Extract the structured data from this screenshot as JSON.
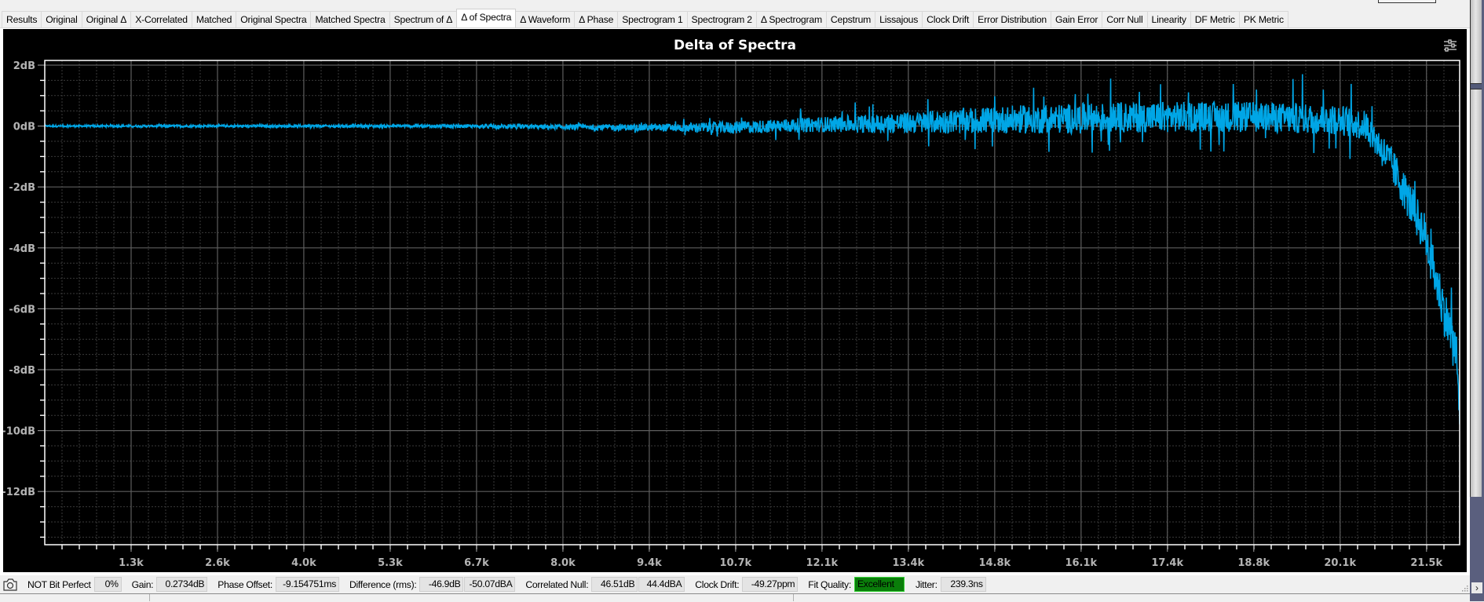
{
  "tabs": [
    {
      "label": "Results"
    },
    {
      "label": "Original"
    },
    {
      "label": "Original Δ"
    },
    {
      "label": "X-Correlated"
    },
    {
      "label": "Matched"
    },
    {
      "label": "Original Spectra"
    },
    {
      "label": "Matched Spectra"
    },
    {
      "label": "Spectrum of Δ"
    },
    {
      "label": "Δ of Spectra",
      "active": true
    },
    {
      "label": "Δ Waveform"
    },
    {
      "label": "Δ Phase"
    },
    {
      "label": "Spectrogram 1"
    },
    {
      "label": "Spectrogram 2"
    },
    {
      "label": "Δ Spectrogram"
    },
    {
      "label": "Cepstrum"
    },
    {
      "label": "Lissajous"
    },
    {
      "label": "Clock Drift"
    },
    {
      "label": "Error Distribution"
    },
    {
      "label": "Gain Error"
    },
    {
      "label": "Corr Null"
    },
    {
      "label": "Linearity"
    },
    {
      "label": "DF Metric"
    },
    {
      "label": "PK Metric"
    }
  ],
  "chart": {
    "settings_icon": "sliders-icon",
    "trace_color": "#00a6e6"
  },
  "chart_data": {
    "type": "line",
    "title": "Delta of Spectra",
    "xlabel": "",
    "ylabel": "",
    "xlim": [
      0,
      22050
    ],
    "ylim": [
      -13.7,
      2.2
    ],
    "grid": true,
    "legend": "none",
    "x_ticks": [
      {
        "value": 1346,
        "label": "1.3k"
      },
      {
        "value": 2692,
        "label": "2.6k"
      },
      {
        "value": 4037,
        "label": "4.0k"
      },
      {
        "value": 5383,
        "label": "5.3k"
      },
      {
        "value": 6729,
        "label": "6.7k"
      },
      {
        "value": 8075,
        "label": "8.0k"
      },
      {
        "value": 9421,
        "label": "9.4k"
      },
      {
        "value": 10766,
        "label": "10.7k"
      },
      {
        "value": 12112,
        "label": "12.1k"
      },
      {
        "value": 13458,
        "label": "13.4k"
      },
      {
        "value": 14804,
        "label": "14.8k"
      },
      {
        "value": 16150,
        "label": "16.1k"
      },
      {
        "value": 17495,
        "label": "17.4k"
      },
      {
        "value": 18841,
        "label": "18.8k"
      },
      {
        "value": 20187,
        "label": "20.1k"
      },
      {
        "value": 21533,
        "label": "21.5k"
      }
    ],
    "y_ticks": [
      {
        "value": 2,
        "label": "2dB"
      },
      {
        "value": 0,
        "label": "0dB"
      },
      {
        "value": -2,
        "label": "-2dB"
      },
      {
        "value": -4,
        "label": "-4dB"
      },
      {
        "value": -6,
        "label": "-6dB"
      },
      {
        "value": -8,
        "label": "-8dB"
      },
      {
        "value": -10,
        "label": "-10dB"
      },
      {
        "value": -12,
        "label": "-12dB"
      }
    ],
    "series": [
      {
        "name": "Delta of Spectra",
        "description": "Noisy delta trace: envelope given as frequency (Hz), mean (dB), spread (dB, +/- noise), max spike (dB)",
        "envelope": [
          {
            "f": 0,
            "mean": 0.0,
            "spread": 0.03,
            "spike": 0.05
          },
          {
            "f": 6000,
            "mean": 0.0,
            "spread": 0.05,
            "spike": 0.08
          },
          {
            "f": 8000,
            "mean": -0.03,
            "spread": 0.08,
            "spike": 0.15
          },
          {
            "f": 9500,
            "mean": -0.05,
            "spread": 0.12,
            "spike": 0.25
          },
          {
            "f": 10700,
            "mean": -0.05,
            "spread": 0.2,
            "spike": 0.45
          },
          {
            "f": 12100,
            "mean": 0.05,
            "spread": 0.25,
            "spike": 0.6
          },
          {
            "f": 13400,
            "mean": 0.1,
            "spread": 0.35,
            "spike": 0.9
          },
          {
            "f": 14800,
            "mean": 0.2,
            "spread": 0.45,
            "spike": 1.1
          },
          {
            "f": 16100,
            "mean": 0.25,
            "spread": 0.5,
            "spike": 1.3
          },
          {
            "f": 17400,
            "mean": 0.3,
            "spread": 0.5,
            "spike": 1.3
          },
          {
            "f": 18800,
            "mean": 0.3,
            "spread": 0.5,
            "spike": 1.3
          },
          {
            "f": 20200,
            "mean": 0.2,
            "spread": 0.5,
            "spike": 1.6
          },
          {
            "f": 20600,
            "mean": 0.0,
            "spread": 0.5,
            "spike": 1.2
          },
          {
            "f": 21000,
            "mean": -1.3,
            "spread": 0.6,
            "spike": 1.0
          },
          {
            "f": 21500,
            "mean": -3.5,
            "spread": 0.7,
            "spike": 1.2
          },
          {
            "f": 21800,
            "mean": -6.0,
            "spread": 0.8,
            "spike": 1.5
          },
          {
            "f": 22000,
            "mean": -7.5,
            "spread": 0.8,
            "spike": 1.8
          },
          {
            "f": 22050,
            "mean": -9.5,
            "spread": 0.5,
            "spike": 0.5
          }
        ],
        "range_summary": {
          "min_db": -10.0,
          "max_db": 2.0
        }
      }
    ]
  },
  "status": {
    "camera_icon": "camera-icon",
    "bit_perfect_label": "NOT Bit Perfect",
    "bit_perfect_value": "0%",
    "gain_label": "Gain:",
    "gain_value": "0.2734dB",
    "phase_label": "Phase Offset:",
    "phase_value": "-9.154751ms",
    "difference_label": "Difference (rms):",
    "difference_db": "-46.9dB",
    "difference_dba": "-50.07dBA",
    "corr_null_label": "Correlated Null:",
    "corr_null_db": "46.51dB",
    "corr_null_dba": "44.4dBA",
    "clock_drift_label": "Clock Drift:",
    "clock_drift_value": "-49.27ppm",
    "fit_quality_label": "Fit Quality:",
    "fit_quality_value": "Excellent",
    "fit_quality_color": "#0a7d0a",
    "jitter_label": "Jitter:",
    "jitter_value": "239.3ns",
    "scroll_right_glyph": "›"
  }
}
